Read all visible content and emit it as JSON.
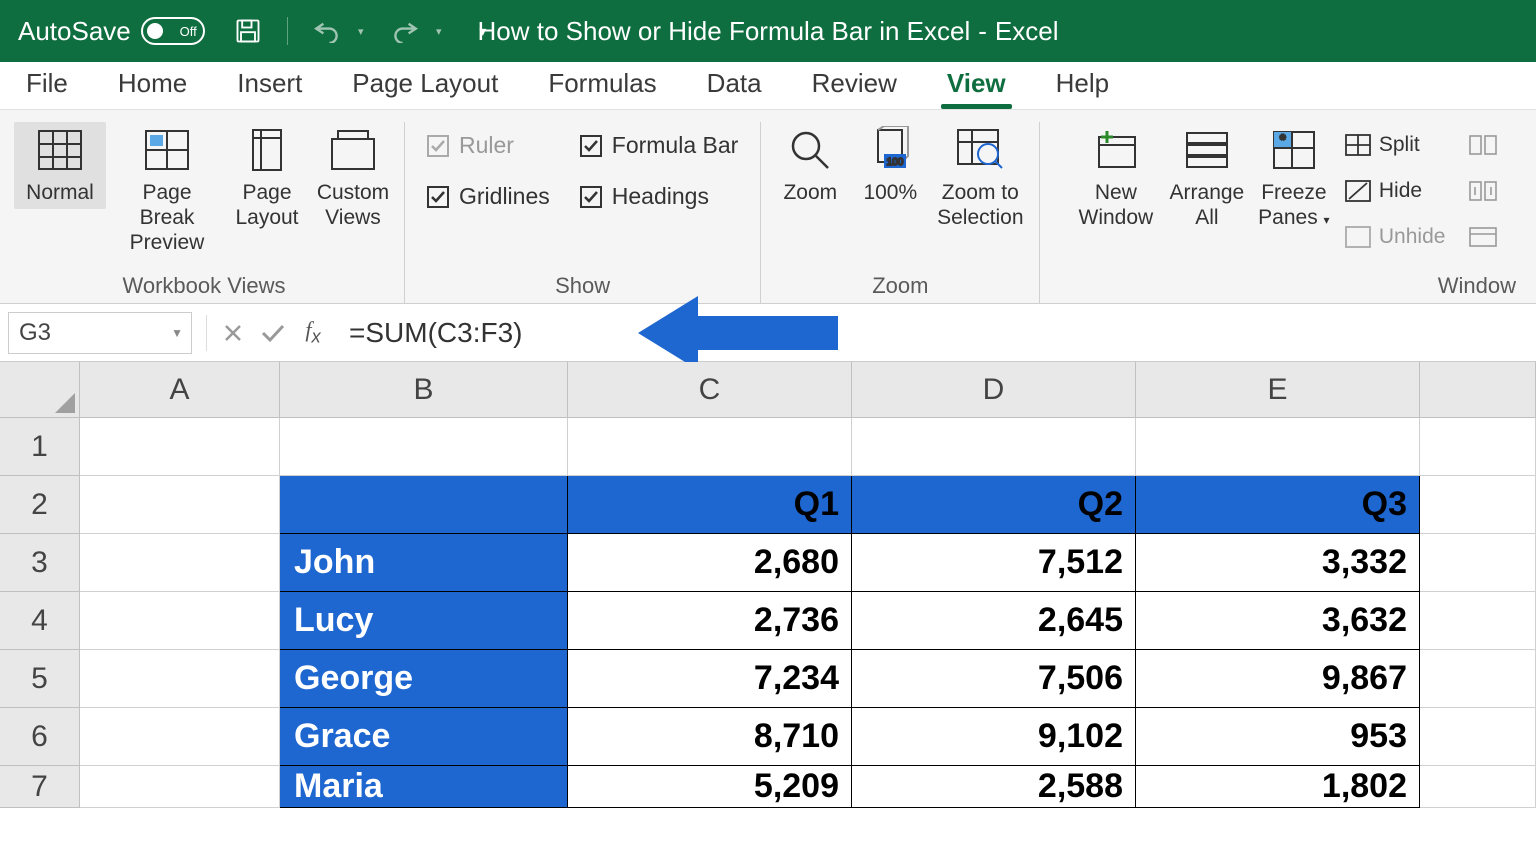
{
  "title": {
    "document": "How to Show or Hide Formula Bar in Excel",
    "app": "Excel"
  },
  "autosave": {
    "label": "AutoSave",
    "state": "Off"
  },
  "menu": {
    "file": "File",
    "home": "Home",
    "insert": "Insert",
    "page_layout": "Page Layout",
    "formulas": "Formulas",
    "data": "Data",
    "review": "Review",
    "view": "View",
    "help": "Help"
  },
  "ribbon": {
    "workbook_views": {
      "label": "Workbook Views",
      "normal": "Normal",
      "page_break": "Page Break Preview",
      "page_layout": "Page Layout",
      "custom": "Custom Views"
    },
    "show": {
      "label": "Show",
      "ruler": "Ruler",
      "formula_bar": "Formula Bar",
      "gridlines": "Gridlines",
      "headings": "Headings"
    },
    "zoom": {
      "label": "Zoom",
      "zoom": "Zoom",
      "p100": "100%",
      "zoom_sel": "Zoom to Selection"
    },
    "window": {
      "label": "Window",
      "new": "New Window",
      "arrange": "Arrange All",
      "freeze": "Freeze Panes",
      "split": "Split",
      "hide": "Hide",
      "unhide": "Unhide"
    }
  },
  "formula_bar": {
    "cell_ref": "G3",
    "formula": "=SUM(C3:F3)"
  },
  "columns": {
    "A": "A",
    "B": "B",
    "C": "C",
    "D": "D",
    "E": "E"
  },
  "rows": {
    "r1": "1",
    "r2": "2",
    "r3": "3",
    "r4": "4",
    "r5": "5",
    "r6": "6",
    "r7": "7"
  },
  "headers": {
    "q1": "Q1",
    "q2": "Q2",
    "q3": "Q3"
  },
  "data": {
    "r3": {
      "name": "John",
      "q1": "2,680",
      "q2": "7,512",
      "q3": "3,332"
    },
    "r4": {
      "name": "Lucy",
      "q1": "2,736",
      "q2": "2,645",
      "q3": "3,632"
    },
    "r5": {
      "name": "George",
      "q1": "7,234",
      "q2": "7,506",
      "q3": "9,867"
    },
    "r6": {
      "name": "Grace",
      "q1": "8,710",
      "q2": "9,102",
      "q3": "953"
    },
    "r7": {
      "name": "Maria",
      "q1": "5,209",
      "q2": "2,588",
      "q3": "1,802"
    }
  }
}
